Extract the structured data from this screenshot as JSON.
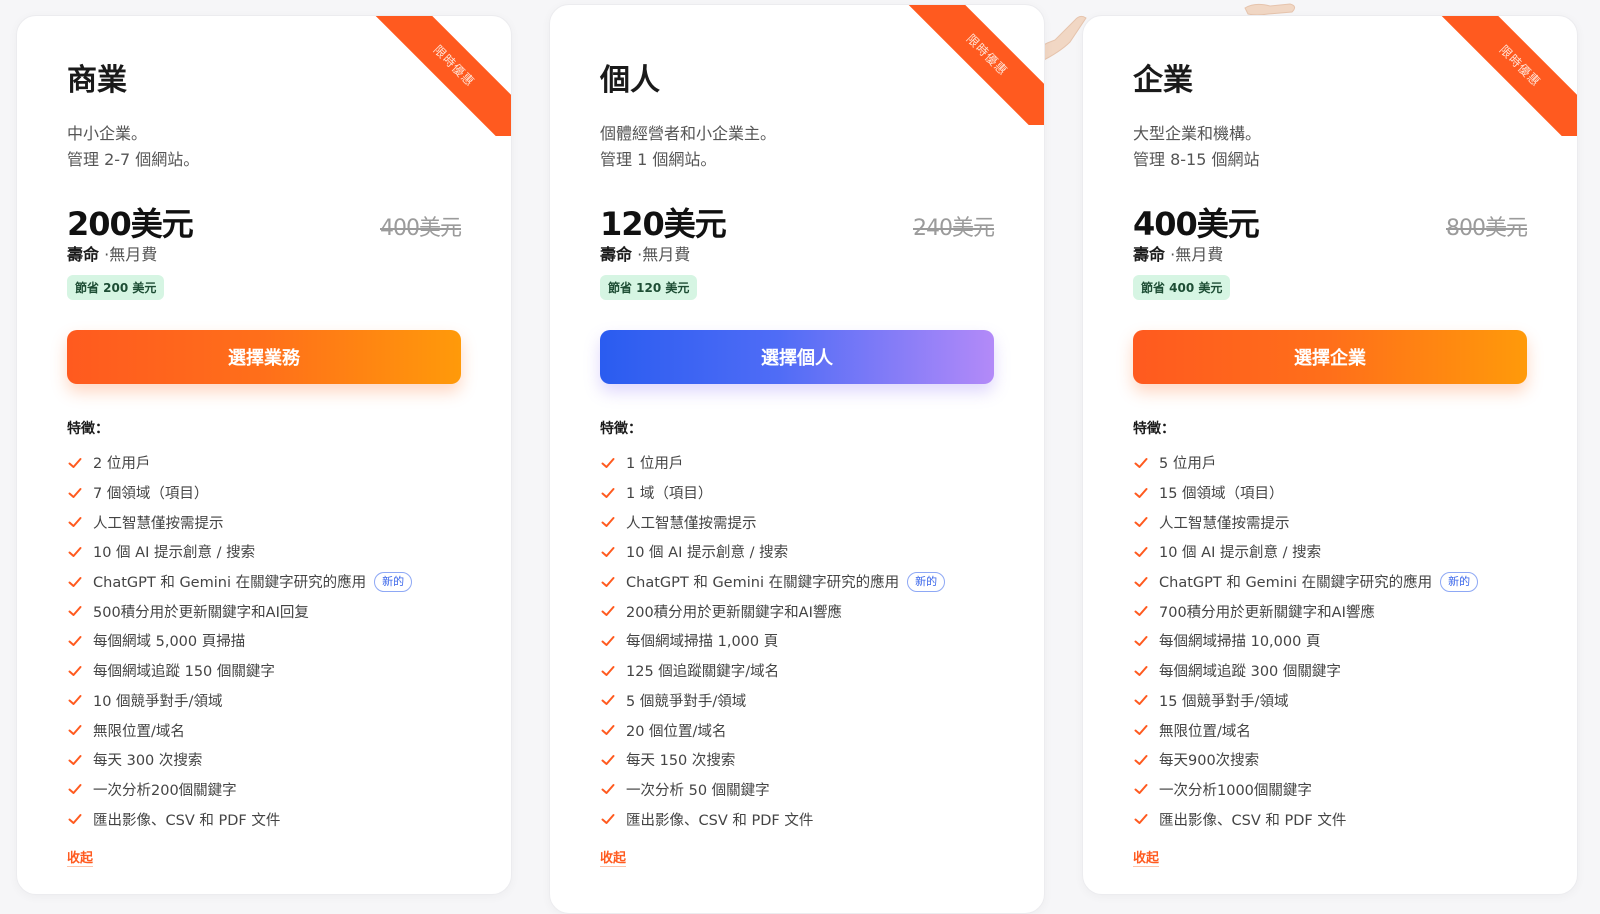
{
  "colors": {
    "accent_orange": "#ff5a1f",
    "accent_blue": "#2a5cf0",
    "accent_purple": "#b38af8",
    "badge_green_bg": "#d6f5e3",
    "check_color": "#ff5a1f"
  },
  "ribbon_text": "限時優惠",
  "features_label": "特徵：",
  "new_badge_label": "新的",
  "collapse_label": "收起",
  "lifetime_bold": "壽命",
  "lifetime_rest": "·無月費",
  "plans": [
    {
      "title": "商業",
      "desc_line1": "中小企業。",
      "desc_line2": "管理 2-7 個網站。",
      "price": "200美元",
      "old_price": "400美元",
      "save": "節省 200 美元",
      "cta": "選擇業務",
      "features": [
        "2 位用戶",
        "7 個領域（項目）",
        "人工智慧僅按需提示",
        "10 個 AI 提示創意 / 搜索",
        "ChatGPT 和 Gemini 在關鍵字研究的應用",
        "500積分用於更新關鍵字和AI回复",
        "每個網域 5,000 頁掃描",
        "每個網域追蹤 150 個關鍵字",
        "10 個競爭對手/領域",
        "無限位置/域名",
        "每天 300 次搜索",
        "一次分析200個關鍵字",
        "匯出影像、CSV 和 PDF 文件"
      ]
    },
    {
      "title": "個人",
      "desc_line1": "個體經營者和小企業主。",
      "desc_line2": "管理 1 個網站。",
      "price": "120美元",
      "old_price": "240美元",
      "save": "節省 120 美元",
      "cta": "選擇個人",
      "features": [
        "1 位用戶",
        "1 域（項目）",
        "人工智慧僅按需提示",
        "10 個 AI 提示創意 / 搜索",
        "ChatGPT 和 Gemini 在關鍵字研究的應用",
        "200積分用於更新關鍵字和AI響應",
        "每個網域掃描 1,000 頁",
        "125 個追蹤關鍵字/域名",
        "5 個競爭對手/領域",
        "20 個位置/域名",
        "每天 150 次搜索",
        "一次分析 50 個關鍵字",
        "匯出影像、CSV 和 PDF 文件"
      ]
    },
    {
      "title": "企業",
      "desc_line1": "大型企業和機構。",
      "desc_line2": "管理 8-15 個網站",
      "price": "400美元",
      "old_price": "800美元",
      "save": "節省 400 美元",
      "cta": "選擇企業",
      "features": [
        "5 位用戶",
        "15 個領域（項目）",
        "人工智慧僅按需提示",
        "10 個 AI 提示創意 / 搜索",
        "ChatGPT 和 Gemini 在關鍵字研究的應用",
        "700積分用於更新關鍵字和AI響應",
        "每個網域掃描 10,000 頁",
        "每個網域追蹤 300 個關鍵字",
        "15 個競爭對手/領域",
        "無限位置/域名",
        "每天900次搜索",
        "一次分析1000個關鍵字",
        "匯出影像、CSV 和 PDF 文件"
      ]
    }
  ]
}
